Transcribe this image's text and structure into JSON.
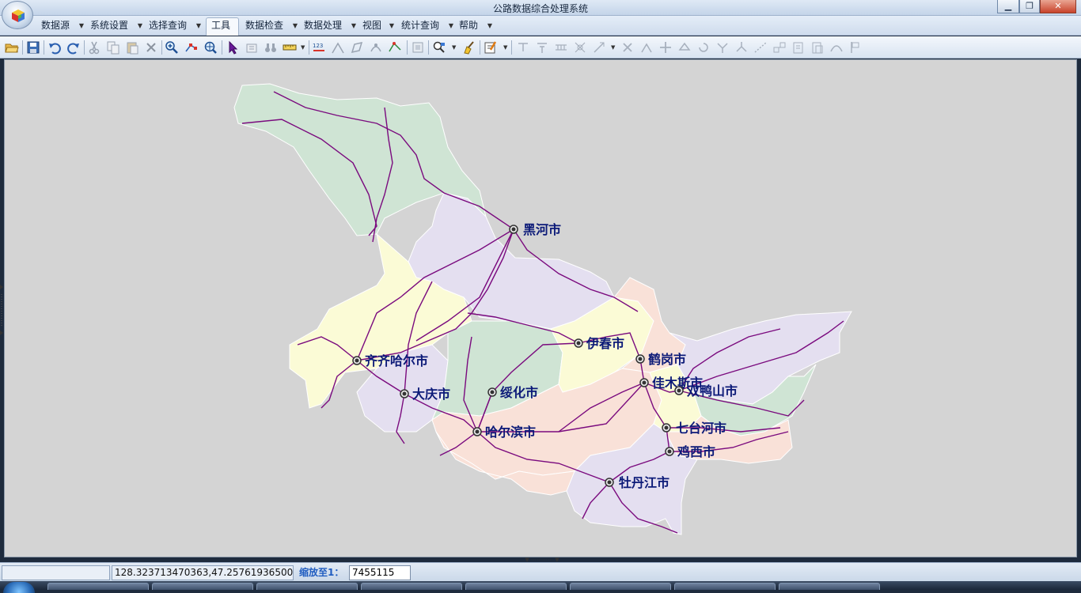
{
  "window": {
    "title": "公路数据综合处理系统",
    "buttons": {
      "minimize": "▁",
      "restore": "❐",
      "close": "✕"
    }
  },
  "menu": [
    {
      "label": "数据源"
    },
    {
      "label": "系统设置"
    },
    {
      "label": "选择查询"
    },
    {
      "label": "工具",
      "active": true
    },
    {
      "label": "数据检查"
    },
    {
      "label": "数据处理"
    },
    {
      "label": "视图"
    },
    {
      "label": "统计查询"
    },
    {
      "label": "帮助"
    }
  ],
  "map": {
    "colors": {
      "background": "#d4d4d4",
      "green": "#cfe4d4",
      "lavender": "#e4dff0",
      "yellow": "#fbfbd6",
      "peach": "#f9e1d8",
      "road": "#7a0a7e",
      "label": "#0c1a78"
    },
    "cities": [
      {
        "name": "黑河市"
      },
      {
        "name": "伊春市"
      },
      {
        "name": "鹤岗市"
      },
      {
        "name": "齐齐哈尔市"
      },
      {
        "name": "佳木斯市"
      },
      {
        "name": "双鸭山市"
      },
      {
        "name": "大庆市"
      },
      {
        "name": "绥化市"
      },
      {
        "name": "哈尔滨市"
      },
      {
        "name": "七台河市"
      },
      {
        "name": "鸡西市"
      },
      {
        "name": "牡丹江市"
      }
    ]
  },
  "status": {
    "panel1": "",
    "coordinates": "128.323713470363,47.25761936500...",
    "zoom_label": "缩放至1：",
    "zoom_value": "7455115"
  }
}
